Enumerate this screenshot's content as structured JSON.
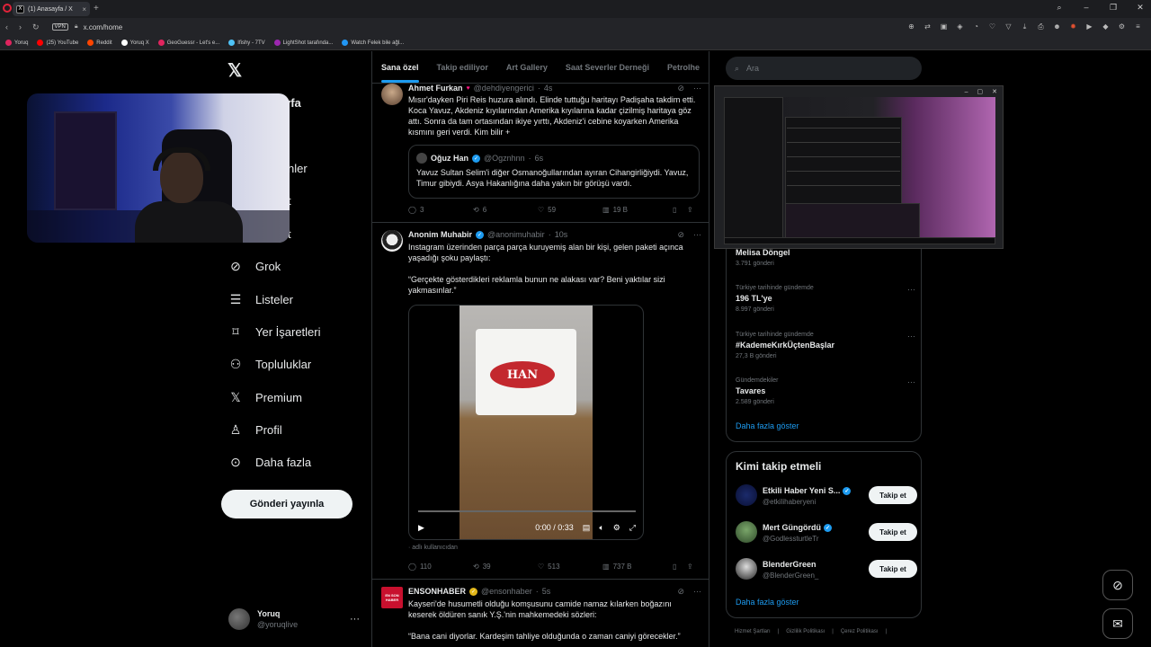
{
  "browser": {
    "tab_title": "(1) Anasayfa / X",
    "url": "x.com/home",
    "vpn_label": "VPN",
    "bookmarks": [
      {
        "label": "Yoruq",
        "color": "#e0245e"
      },
      {
        "label": "(25) YouTube",
        "color": "#ff0000"
      },
      {
        "label": "Reddit",
        "color": "#ff4500"
      },
      {
        "label": "Yoruq X",
        "color": "#ffffff"
      },
      {
        "label": "GeoGuessr - Let's e...",
        "color": "#e0245e"
      },
      {
        "label": "Ifishy - 7TV",
        "color": "#4fc3f7"
      },
      {
        "label": "LightShot tarafında...",
        "color": "#9c27b0"
      },
      {
        "label": "Watch Felek bile ağl...",
        "color": "#2196f3"
      }
    ]
  },
  "nav": {
    "partial_title": "yfa",
    "partial_1": "nler",
    "partial_2": "t",
    "partial_3": "t",
    "items": [
      {
        "label": "Grok",
        "icon": "grok-icon"
      },
      {
        "label": "Listeler",
        "icon": "list-icon"
      },
      {
        "label": "Yer İşaretleri",
        "icon": "bookmark-icon"
      },
      {
        "label": "Topluluklar",
        "icon": "communities-icon"
      },
      {
        "label": "Premium",
        "icon": "x-premium-icon"
      },
      {
        "label": "Profil",
        "icon": "profile-icon"
      },
      {
        "label": "Daha fazla",
        "icon": "more-circle-icon"
      }
    ],
    "post_button": "Gönderi yayınla",
    "account": {
      "name": "Yoruq",
      "handle": "@yoruqlive"
    }
  },
  "feed": {
    "tabs": [
      "Sana özel",
      "Takip ediliyor",
      "Art Gallery",
      "Saat Severler Derneği",
      "Petrolhe"
    ],
    "tweets": [
      {
        "name": "Ahmet Furkan",
        "handle": "@dehdiyengerici",
        "time": "4s",
        "text": "Mısır'dayken Piri Reis huzura alındı. Elinde tuttuğu haritayı Padişaha takdim etti. Koca Yavuz, Akdeniz kıyılarından Amerika kıyılarına kadar çizilmiş haritaya göz attı. Sonra da tam ortasından ikiye yırttı, Akdeniz'i cebine koyarken Amerika kısmını geri verdi. Kim bilir +",
        "quote": {
          "name": "Oğuz Han",
          "handle": "@Ogznhnn",
          "time": "6s",
          "text": "Yavuz Sultan Selim'i diğer Osmanoğullarından ayıran Cihangirliğiydi. Yavuz, Timur gibiydi. Asya Hakanlığına daha yakın bir görüşü vardı."
        },
        "replies": "3",
        "reposts": "6",
        "likes": "59",
        "views": "19 B"
      },
      {
        "name": "Anonim Muhabir",
        "handle": "@anonimuhabir",
        "time": "10s",
        "text": "Instagram üzerinden parça parça kuruyemiş alan bir kişi, gelen paketi açınca yaşadığı şoku paylaştı:\n\n“Gerçekte gösterdikleri reklamla bunun ne alakası var? Beni yaktılar sizi yakmasınlar.”",
        "video_logo": "HAN",
        "video_time": "0:00 / 0:33",
        "via": "adlı kullanıcıdan",
        "replies": "110",
        "reposts": "39",
        "likes": "513",
        "views": "737 B"
      },
      {
        "name": "ENSONHABER",
        "handle": "@ensonhaber",
        "time": "5s",
        "avatar_text": "EN SON HABER",
        "text": "Kayseri'de husumetli olduğu komşusunu camide namaz kılarken boğazını keserek öldüren sanık Y.Ş.'nin mahkemedeki sözleri:\n\n“Bana cani diyorlar. Kardeşim tahliye olduğunda o zaman caniyi görecekler.”"
      }
    ]
  },
  "right": {
    "search_placeholder": "Ara",
    "trends": [
      {
        "context": "",
        "title": "Melisa Döngel",
        "count": "3.791 gönderi"
      },
      {
        "context": "Türkiye tarihinde gündemde",
        "title": "196 TL'ye",
        "count": "8.997 gönderi"
      },
      {
        "context": "Türkiye tarihinde gündemde",
        "title": "#KademeKırkÜçtenBaşlar",
        "count": "27,3 B gönderi"
      },
      {
        "context": "Gündemdekiler",
        "title": "Tavares",
        "count": "2.589 gönderi"
      }
    ],
    "trends_show_more": "Daha fazla göster",
    "who_to_follow_title": "Kimi takip etmeli",
    "who_to_follow": [
      {
        "name": "Etkili Haber Yeni S...",
        "handle": "@etkilihaberyeni",
        "follow": "Takip et"
      },
      {
        "name": "Mert Güngördü",
        "handle": "@GodlessturtleTr",
        "follow": "Takip et"
      },
      {
        "name": "BlenderGreen",
        "handle": "@BlenderGreen_",
        "follow": "Takip et"
      }
    ],
    "wtf_show_more": "Daha fazla göster",
    "footer": [
      "Hizmet Şartları",
      "|",
      "Gizlilik Politikası",
      "|",
      "Çerez Politikası",
      "|"
    ]
  },
  "colors": {
    "accent": "#1d9bf0",
    "background": "#000000",
    "border": "#2f3336",
    "muted": "#71767b"
  }
}
